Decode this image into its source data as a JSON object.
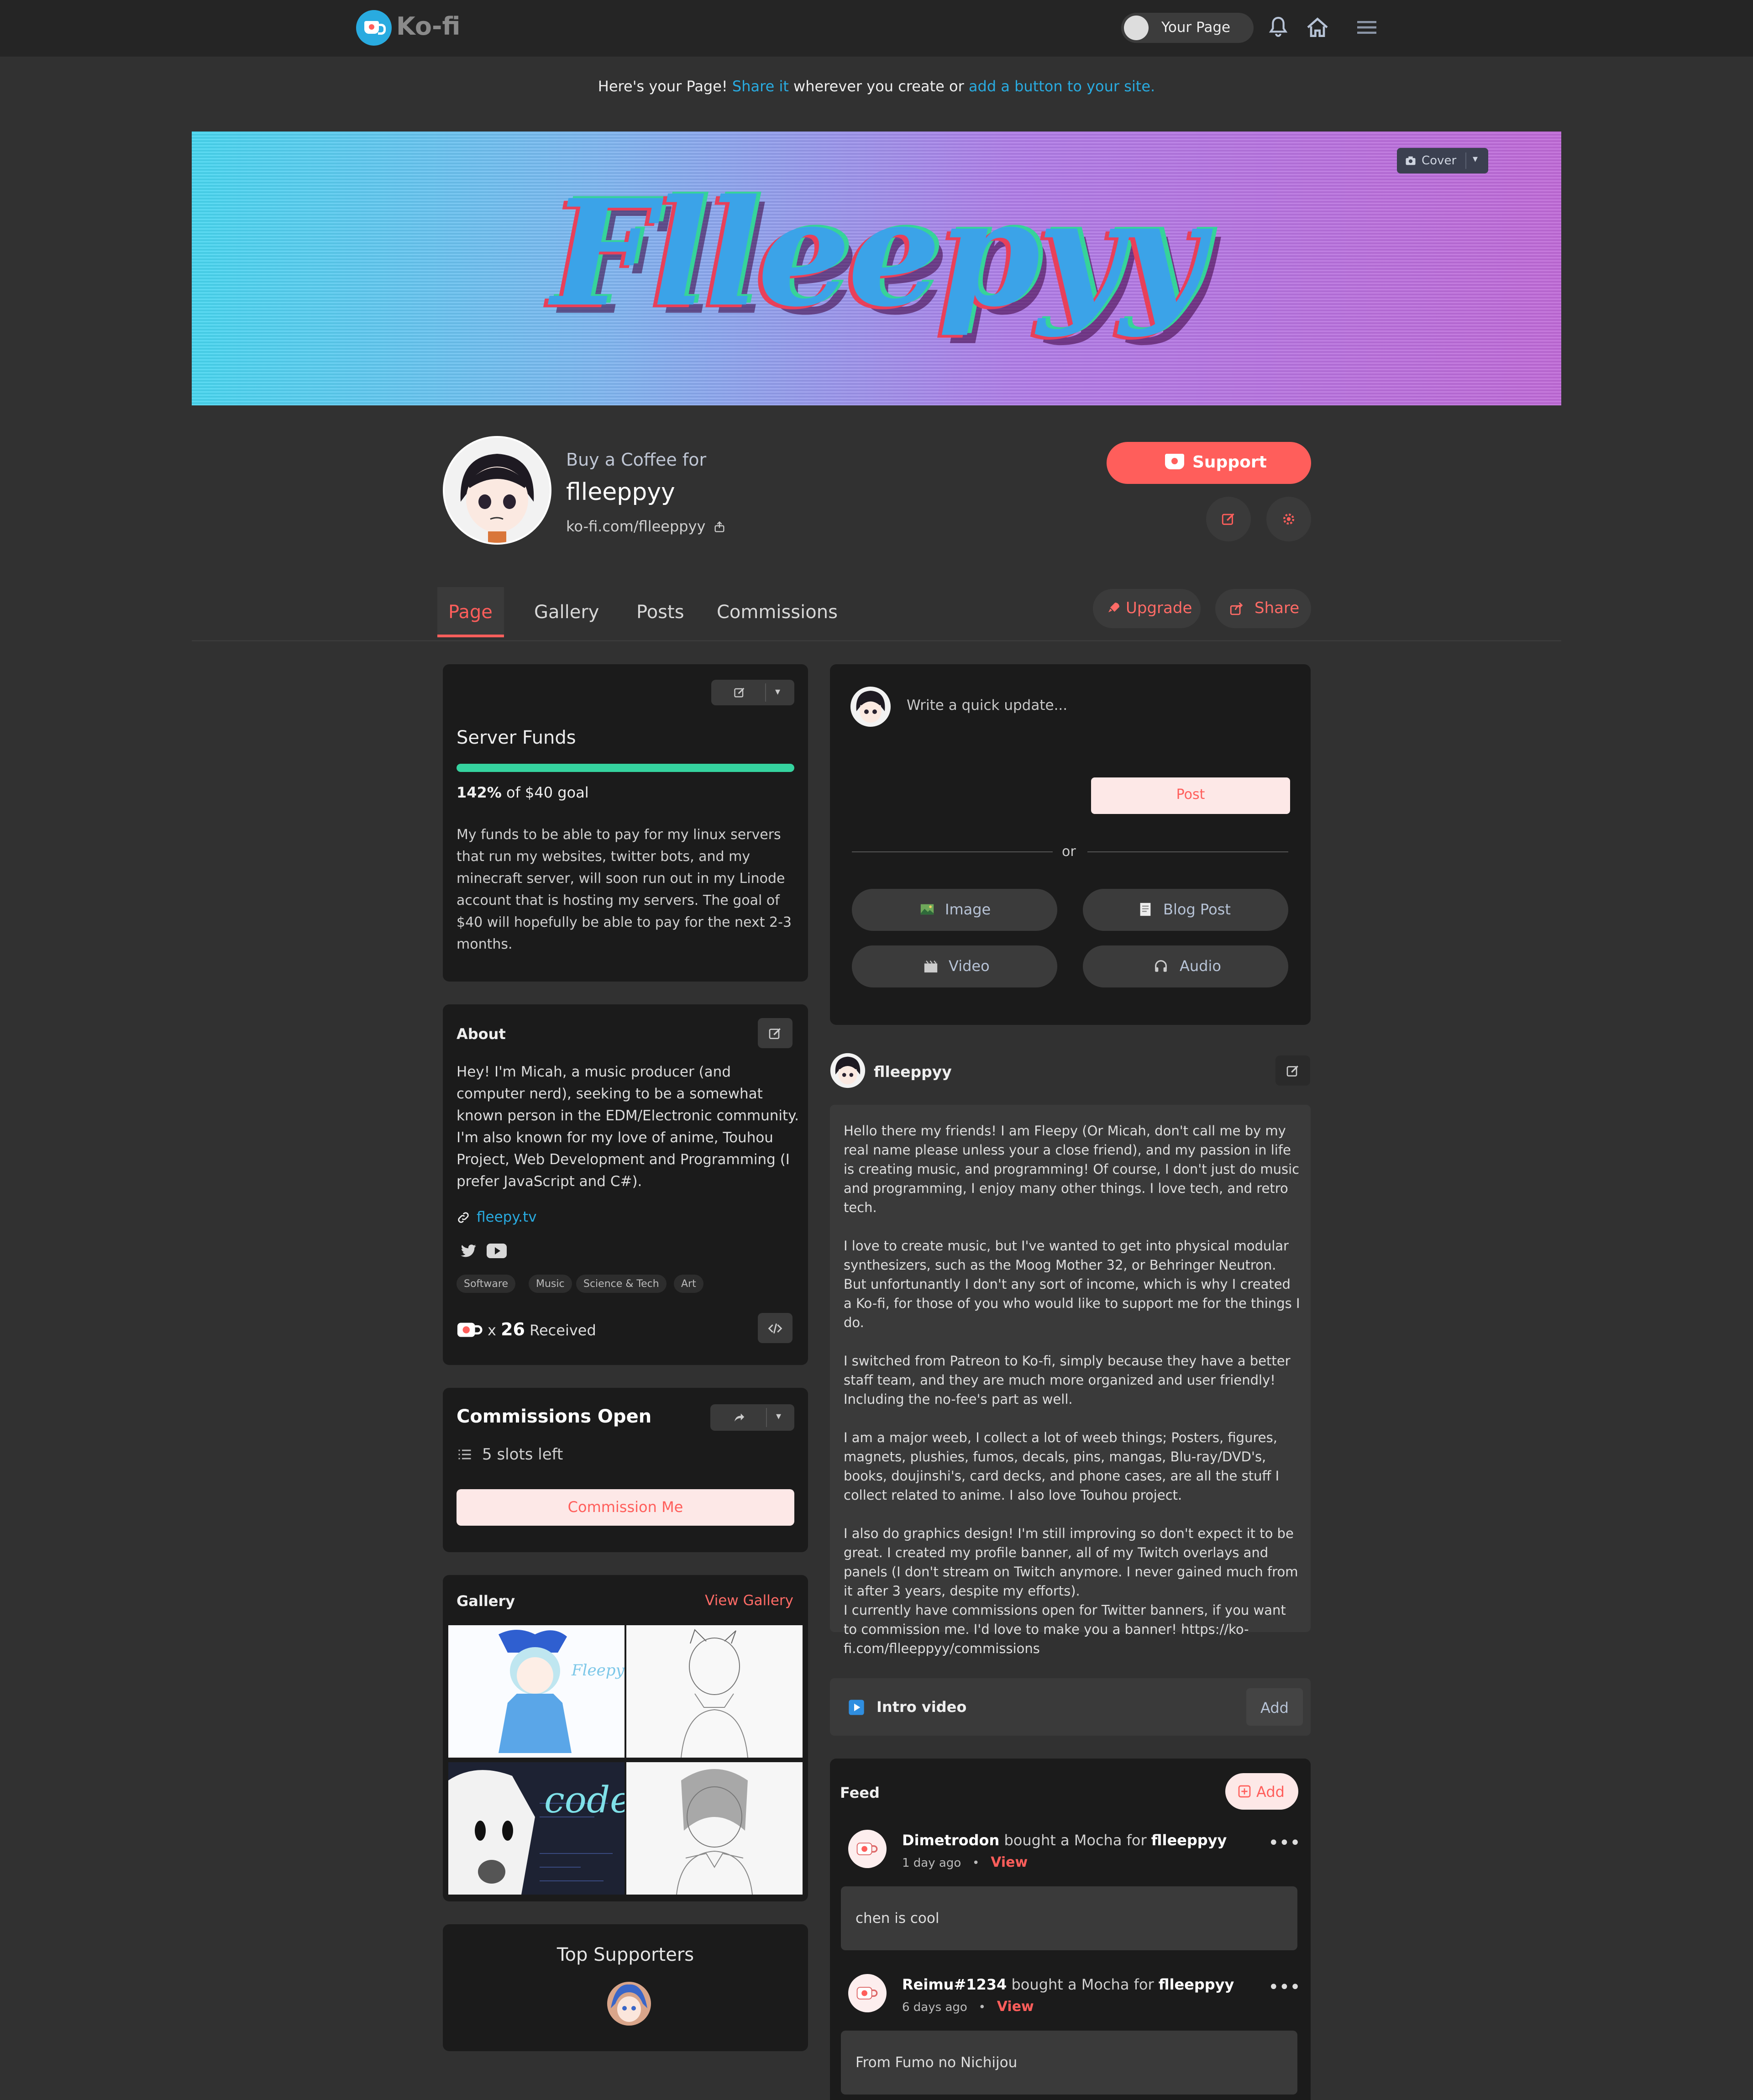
{
  "nav": {
    "brand": "Ko-fi",
    "your_page": "Your Page"
  },
  "notice": {
    "prefix": "Here's your Page! ",
    "share_link": "Share it",
    "middle": " wherever you create or ",
    "button_link": "add a button to your site."
  },
  "cover": {
    "title_art": "Flleepyy",
    "cover_button": "Cover"
  },
  "profile": {
    "buy_for": "Buy a Coffee for",
    "name": "flleeppyy",
    "url": "ko-fi.com/flleeppyy",
    "support_button": "Support"
  },
  "tabs": [
    "Page",
    "Gallery",
    "Posts",
    "Commissions"
  ],
  "actions": {
    "upgrade": "Upgrade",
    "share": "Share"
  },
  "goal": {
    "title": "Server Funds",
    "percent": "142%",
    "percent_value": 1.0,
    "of_goal": "of $40 goal",
    "description": "My funds to be able to pay for my linux servers that run my websites, twitter bots, and my minecraft server, will soon run out in my Linode account that is hosting my servers. The goal of $40 will hopefully be able to pay for the next 2-3 months."
  },
  "about": {
    "title": "About",
    "description": "Hey! I'm Micah, a music producer (and computer nerd), seeking to be a somewhat known person in the EDM/Electronic community. I'm also known for my love of anime, Touhou Project, Web Development and Programming (I prefer JavaScript and C#).",
    "link": "fleepy.tv",
    "tags": [
      "Software",
      "Music",
      "Science & Tech",
      "Art"
    ],
    "received_prefix": "x",
    "received_count": "26",
    "received_label": "Received"
  },
  "commissions": {
    "title": "Commissions Open",
    "slots": "5 slots left",
    "button": "Commission Me"
  },
  "gallery": {
    "title": "Gallery",
    "view_all": "View Gallery"
  },
  "supporters": {
    "title": "Top Supporters"
  },
  "composer": {
    "placeholder": "Write a quick update...",
    "post_button": "Post",
    "or": "or",
    "image": "Image",
    "blog_post": "Blog Post",
    "video": "Video",
    "audio": "Audio"
  },
  "about_post": {
    "user": "flleeppyy",
    "paragraphs": [
      "Hello there my friends! I am Fleepy (Or Micah, don't call me by my real name please unless your a close friend), and my passion in life is creating music, and programming! Of course, I don't just do music and programming, I enjoy many other things. I love tech, and retro tech.",
      "I love to create music, but I've wanted to get into physical modular synthesizers, such as the Moog Mother 32, or Behringer Neutron. But unfortunantly I don't any sort of income, which is why I created a Ko-fi, for those of you who would like to support me for the things I do.",
      "I switched from Patreon to Ko-fi, simply because they have a better staff team, and they are much more organized and user friendly! Including the no-fee's part as well.",
      "I am a major weeb, I collect a lot of weeb things; Posters, figures, magnets, plushies, fumos, decals, pins, mangas, Blu-ray/DVD's, books, doujinshi's, card decks, and phone cases, are all the stuff I collect related to anime. I also love Touhou project.",
      "I also do graphics design! I'm still improving so don't expect it to be great. I created my profile banner, all of my Twitch overlays and panels (I don't stream on Twitch anymore. I never gained much from it after 3 years, despite my efforts).\nI currently have commissions open for Twitter banners, if you want to commission me. I'd love to make you a banner! https://ko-fi.com/flleeppyy/commissions"
    ]
  },
  "intro_video": {
    "label": "Intro video",
    "add": "Add"
  },
  "feed": {
    "title": "Feed",
    "add": "Add",
    "items": [
      {
        "user": "Dimetrodon",
        "action": " bought a Mocha for ",
        "target": "flleeppyy",
        "time": "1 day ago",
        "view": "View",
        "message": "chen is cool"
      },
      {
        "user": "Reimu#1234",
        "action": " bought a Mocha for ",
        "target": "flleeppyy",
        "time": "6 days ago",
        "view": "View",
        "message": "From Fumo no Nichijou"
      }
    ]
  },
  "colors": {
    "accent": "#ff5e5b",
    "link": "#29abe0",
    "progress": "#35d39f",
    "bg": "#313131",
    "card": "#1b1b1b"
  }
}
